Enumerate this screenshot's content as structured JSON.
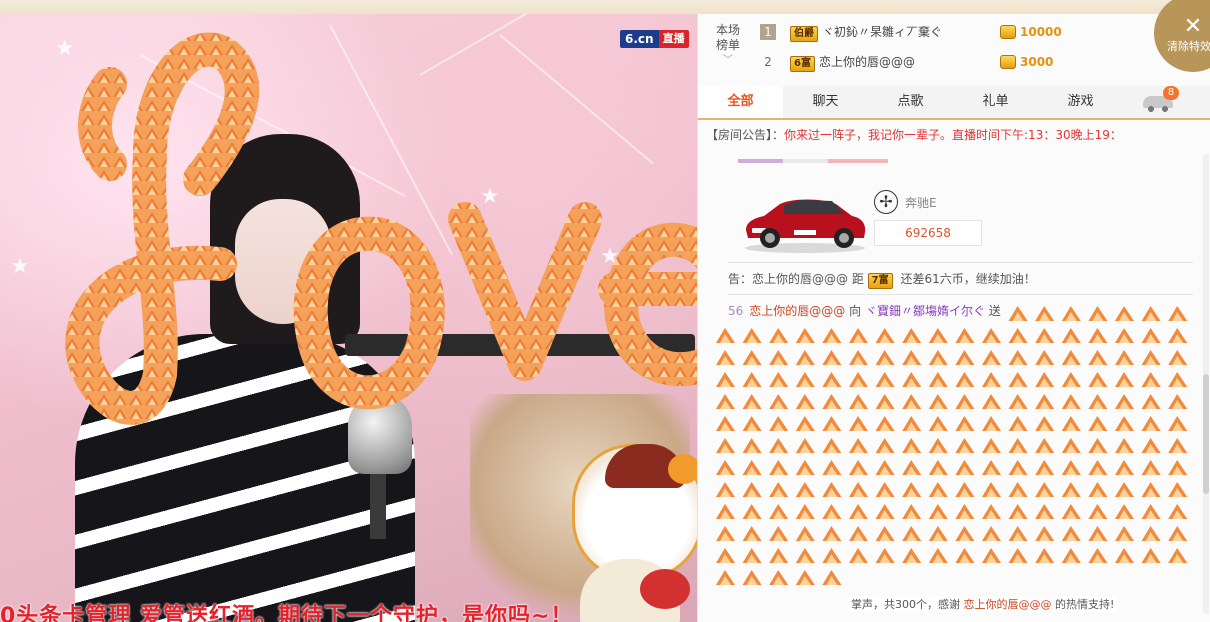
{
  "video": {
    "brand": "6.cn",
    "live_badge": "直播",
    "ticker": "0头条卡管理    爱管送红酒。期待下一个守护，是你吗~！"
  },
  "leaderboard": {
    "title_line1": "本场",
    "title_line2": "榜单",
    "rows": [
      {
        "rank": "1",
        "badge": "伯爵",
        "name": "ヾ初鈊〃杲雛ィ丆棄ぐ",
        "score": "10000"
      },
      {
        "rank": "2",
        "badge": "6富",
        "name": "恋上你的唇@@@",
        "score": "3000"
      }
    ]
  },
  "close_effects": "清除特效",
  "tabs": [
    {
      "label": "全部",
      "active": true
    },
    {
      "label": "聊天",
      "active": false
    },
    {
      "label": "点歌",
      "active": false
    },
    {
      "label": "礼单",
      "active": false
    },
    {
      "label": "游戏",
      "active": false
    }
  ],
  "car_tab_count": "8",
  "notice": {
    "label": "【房间公告】：",
    "text": "你来过一阵子，我记你一辈子。直播时间下午:13：30晚上19："
  },
  "car": {
    "brand_name": "奔驰E",
    "user_id": "692658"
  },
  "guard": {
    "prefix": "告：",
    "name": "恋上你的唇@@@",
    "middle": " 距 ",
    "badge": "7富",
    "suffix": " 还差61六币，继续加油！"
  },
  "gift": {
    "time": "56",
    "sender": "恋上你的唇@@@",
    "verb": " 向 ",
    "target": "ヾ寶鈿〃鄒塲媠イ尔ぐ",
    "action": " 送"
  },
  "clap": {
    "prefix": "掌声，共300个，感谢 ",
    "name": "恋上你的唇@@@",
    "suffix": " 的热情支持!"
  },
  "colors": {
    "accent": "#e8541d",
    "gift_orange": "#f08a3c",
    "notice_red": "#e23535",
    "gold": "#e8900c"
  }
}
